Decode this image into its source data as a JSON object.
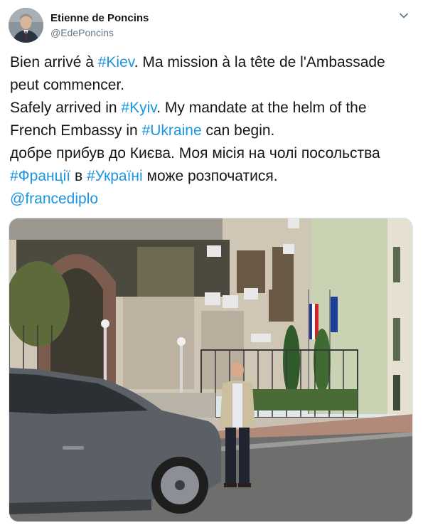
{
  "author": {
    "display_name": "Etienne de Poncins",
    "handle": "@EdePoncins"
  },
  "tweet": {
    "lines": [
      [
        {
          "t": "Bien arrivé à ",
          "link": false
        },
        {
          "t": "#Kiev",
          "link": true
        },
        {
          "t": ". Ma mission à la tête de l'Ambassade",
          "link": false
        }
      ],
      [
        {
          "t": "peut commencer.",
          "link": false
        }
      ],
      [
        {
          "t": "Safely arrived in ",
          "link": false
        },
        {
          "t": "#Kyiv",
          "link": true
        },
        {
          "t": ". My mandate at the helm of the",
          "link": false
        }
      ],
      [
        {
          "t": "French Embassy in ",
          "link": false
        },
        {
          "t": "#Ukraine",
          "link": true
        },
        {
          "t": " can begin.",
          "link": false
        }
      ],
      [
        {
          "t": "добре прибув до Києва. Моя місія на чолі посольства",
          "link": false
        }
      ],
      [
        {
          "t": "#Франції",
          "link": true
        },
        {
          "t": " в ",
          "link": false
        },
        {
          "t": "#Україні",
          "link": true
        },
        {
          "t": " може розпочатися.",
          "link": false
        }
      ],
      [
        {
          "t": "@francediplo",
          "link": true
        }
      ]
    ]
  },
  "colors": {
    "link": "#1b95e0",
    "text": "#14171a",
    "secondary": "#657786"
  },
  "icons": {
    "menu": "chevron-down-icon"
  }
}
